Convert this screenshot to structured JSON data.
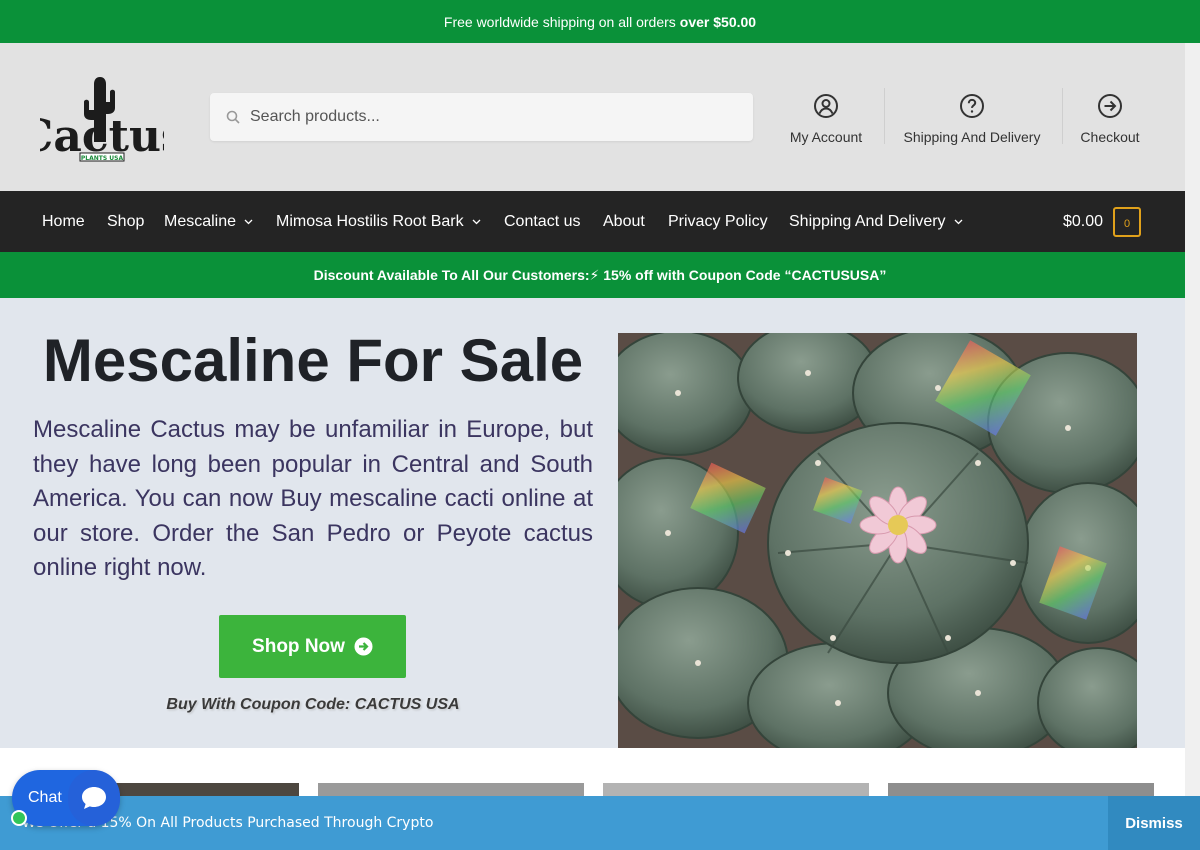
{
  "topbar": {
    "text": "Free worldwide shipping on all orders",
    "bold": "over $50.00"
  },
  "header": {
    "logo_text": "Cactus",
    "logo_subtext": "PLANTS USA",
    "search_placeholder": "Search products...",
    "links": [
      {
        "label": "My Account",
        "icon": "user-circle-icon"
      },
      {
        "label": "Shipping And Delivery",
        "icon": "question-circle-icon"
      },
      {
        "label": "Checkout",
        "icon": "arrow-circle-right-icon"
      }
    ]
  },
  "nav": {
    "items": [
      {
        "label": "Home",
        "has_dropdown": false
      },
      {
        "label": "Shop",
        "has_dropdown": false
      },
      {
        "label": "Mescaline",
        "has_dropdown": true
      },
      {
        "label": "Mimosa Hostilis Root Bark",
        "has_dropdown": true
      },
      {
        "label": "Contact us",
        "has_dropdown": false
      },
      {
        "label": "About",
        "has_dropdown": false
      },
      {
        "label": "Privacy Policy",
        "has_dropdown": false
      },
      {
        "label": "Shipping And Delivery",
        "has_dropdown": true
      }
    ],
    "cart_total": "$0.00",
    "cart_count": "0"
  },
  "promo": {
    "text": "Discount Available To All Our Customers:⚡ 15% off with Coupon Code “CACTUSUSA”"
  },
  "hero": {
    "title": "Mescaline For Sale",
    "text": "Mescaline Cactus may be unfamiliar in Europe, but they have long been popular in Central and South America. You can now Buy mescaline cacti online at our store. Order the San Pedro or Peyote cactus online right now.",
    "button_label": "Shop Now",
    "coupon": "Buy With Coupon Code: CACTUS USA"
  },
  "crypto_notice": {
    "text": "We Offer a 15% On All Products Purchased Through Crypto",
    "dismiss_label": "Dismiss"
  },
  "chat": {
    "label": "Chat"
  },
  "colors": {
    "green": "#0a9139",
    "nav_dark": "#242424",
    "button_green": "#3cb43c",
    "notice_blue": "#3f9bd3",
    "cart_gold": "#e0a11b"
  }
}
